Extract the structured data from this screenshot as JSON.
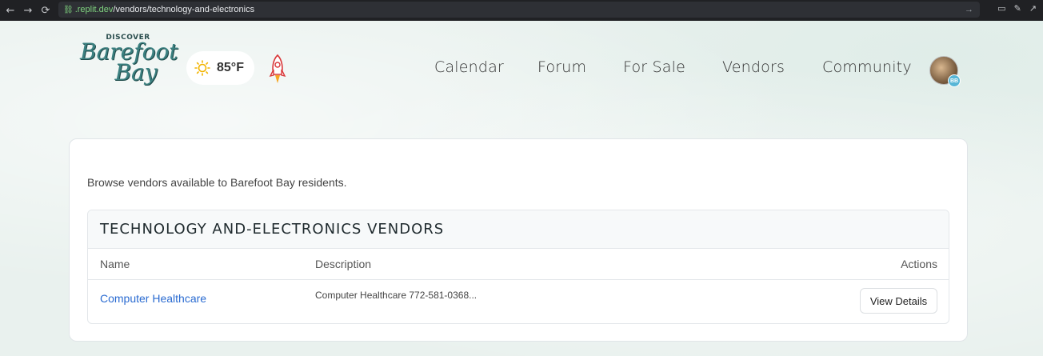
{
  "browser": {
    "url_host": ".replit.dev",
    "url_path": "/vendors/technology-and-electronics"
  },
  "header": {
    "logo_top": "DISCOVER",
    "logo_line1": "Barefoot",
    "logo_line2": "Bay",
    "temperature": "85°F",
    "nav": [
      "Calendar",
      "Forum",
      "For Sale",
      "Vendors",
      "Community"
    ],
    "avatar_initials": "BB"
  },
  "main": {
    "intro": "Browse vendors available to Barefoot Bay residents.",
    "table_title": "TECHNOLOGY AND-ELECTRONICS VENDORS",
    "columns": [
      "Name",
      "Description",
      "Actions"
    ],
    "rows": [
      {
        "name": "Computer Healthcare",
        "description": "Computer Healthcare 772-581-0368...",
        "action": "View Details"
      }
    ]
  },
  "colors": {
    "link": "#2a6bd1",
    "page_bg": "#e9f1ee"
  }
}
